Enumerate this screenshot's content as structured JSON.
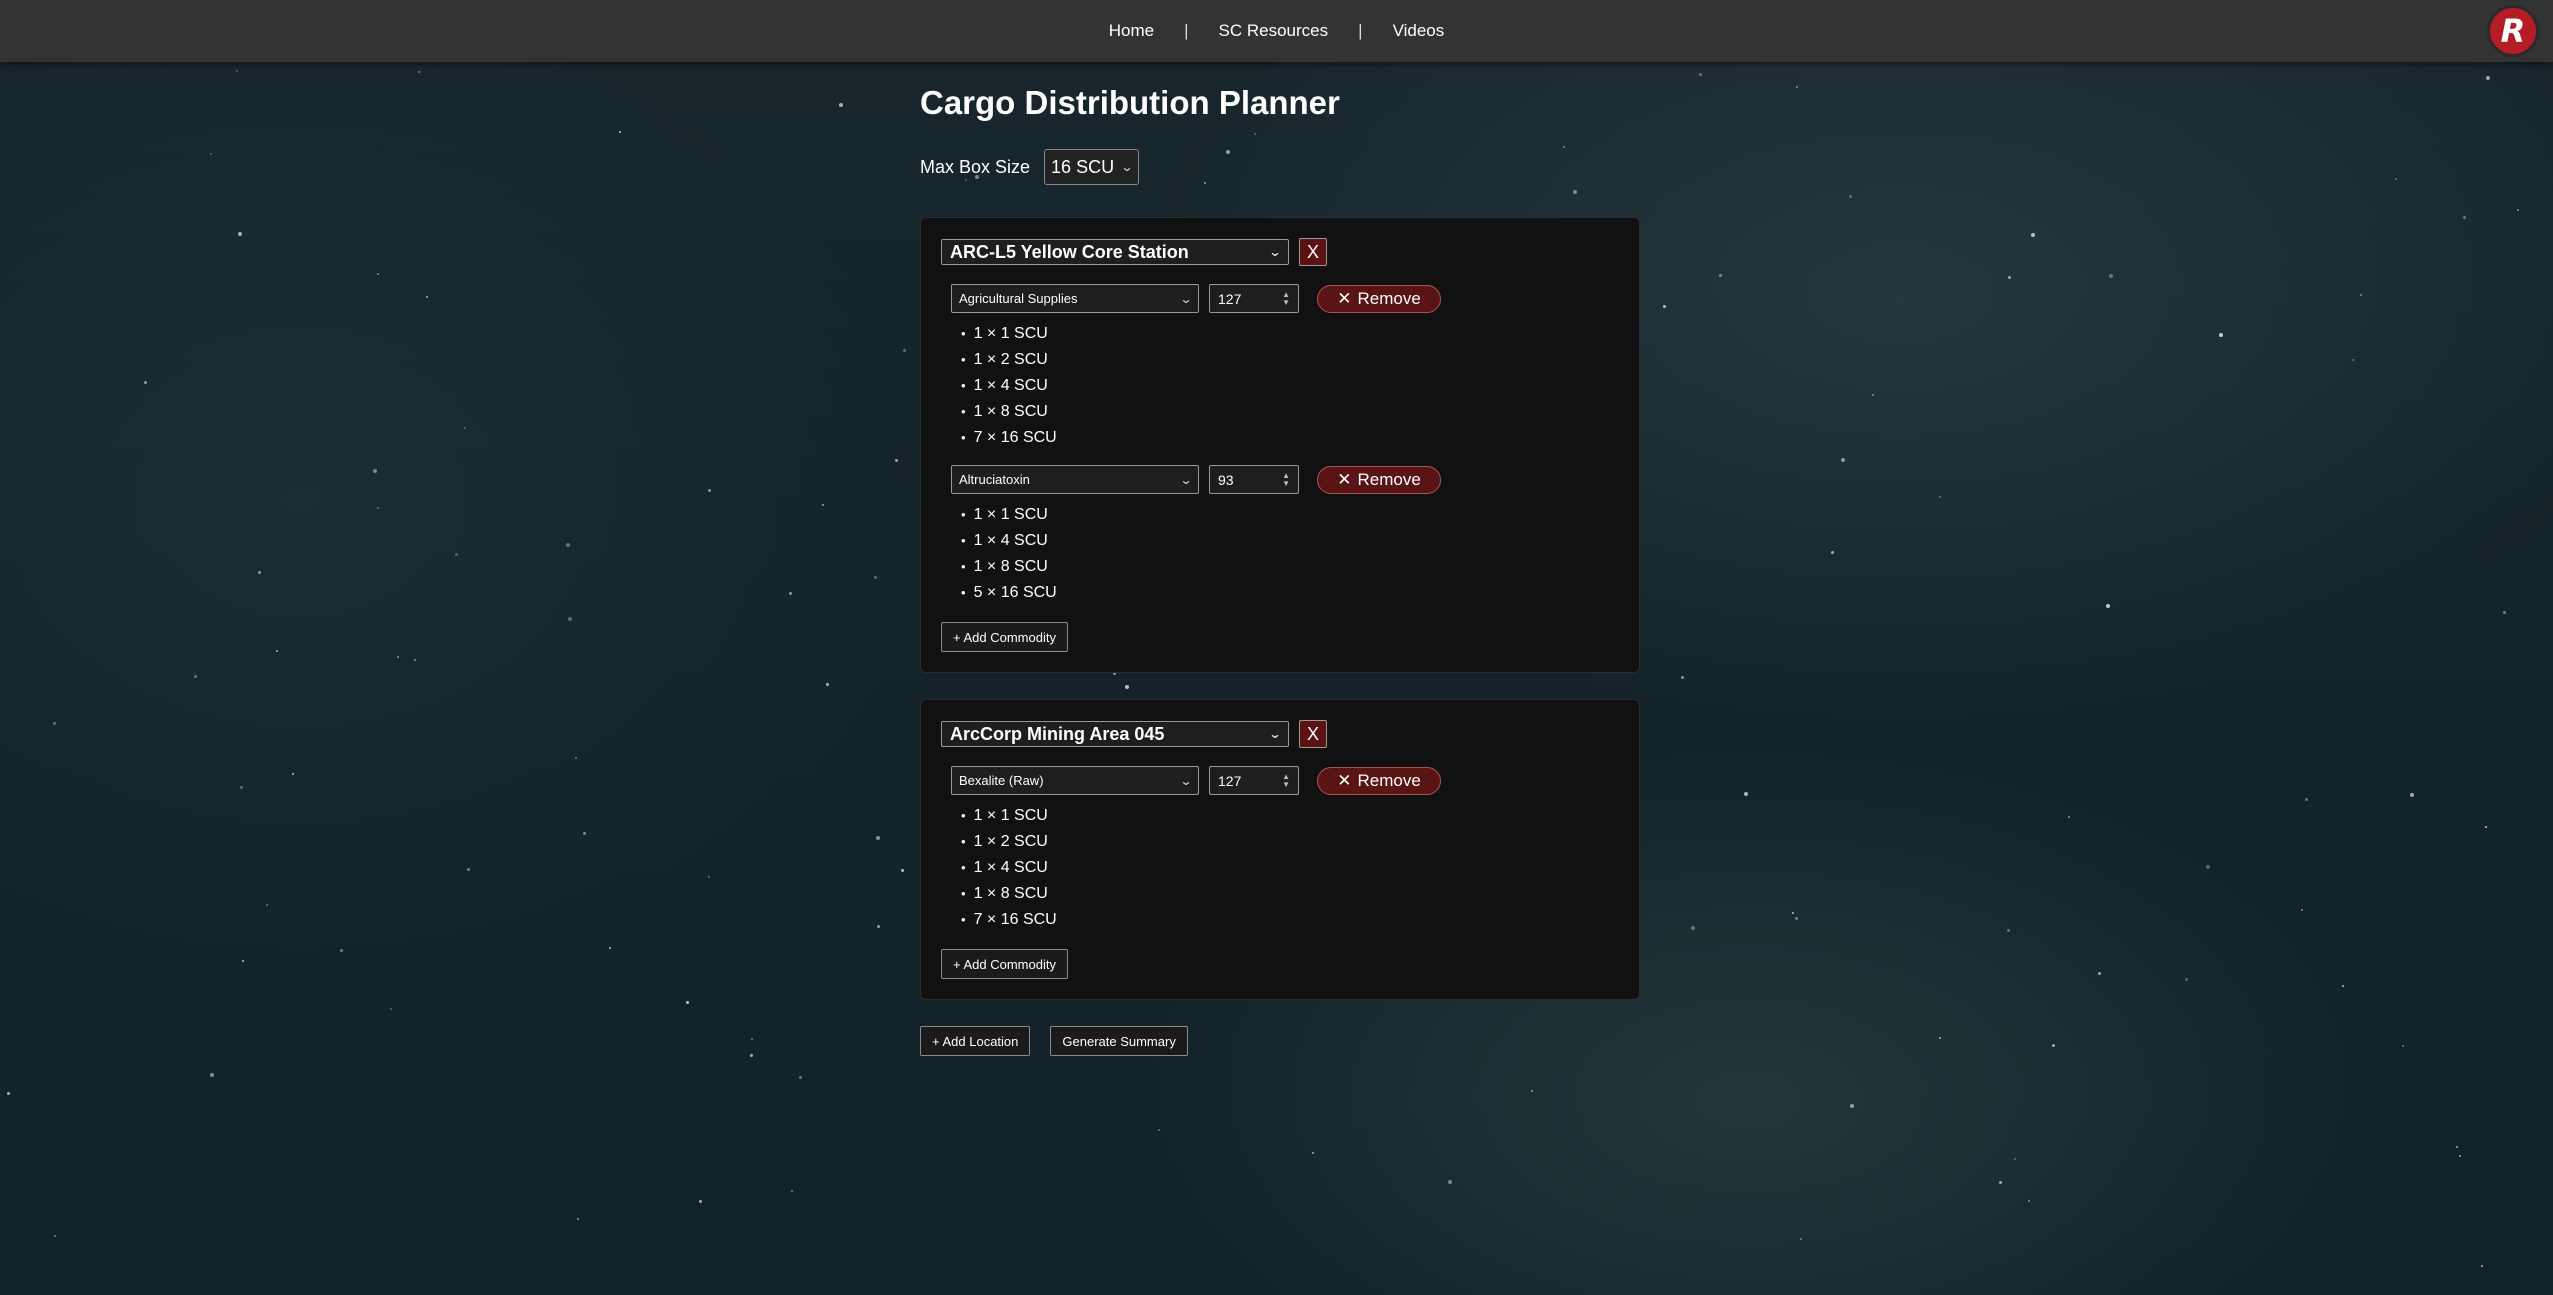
{
  "nav": {
    "items": [
      "Home",
      "SC Resources",
      "Videos"
    ],
    "separator": "|",
    "logo_text": "R"
  },
  "page": {
    "title": "Cargo Distribution Planner",
    "max_box_label": "Max Box Size",
    "max_box_value": "16 SCU"
  },
  "locations": [
    {
      "name": "ARC-L5 Yellow Core Station",
      "remove_label": "X",
      "commodities": [
        {
          "name": "Agricultural Supplies",
          "qty": "127",
          "remove_label": "Remove",
          "breakdown": [
            "1 × 1 SCU",
            "1 × 2 SCU",
            "1 × 4 SCU",
            "1 × 8 SCU",
            "7 × 16 SCU"
          ]
        },
        {
          "name": "Altruciatoxin",
          "qty": "93",
          "remove_label": "Remove",
          "breakdown": [
            "1 × 1 SCU",
            "1 × 4 SCU",
            "1 × 8 SCU",
            "5 × 16 SCU"
          ]
        }
      ],
      "add_commodity_label": "+ Add Commodity"
    },
    {
      "name": "ArcCorp Mining Area 045",
      "remove_label": "X",
      "commodities": [
        {
          "name": "Bexalite (Raw)",
          "qty": "127",
          "remove_label": "Remove",
          "breakdown": [
            "1 × 1 SCU",
            "1 × 2 SCU",
            "1 × 4 SCU",
            "1 × 8 SCU",
            "7 × 16 SCU"
          ]
        }
      ],
      "add_commodity_label": "+ Add Commodity"
    }
  ],
  "actions": {
    "add_location": "+ Add Location",
    "generate_summary": "Generate Summary"
  }
}
